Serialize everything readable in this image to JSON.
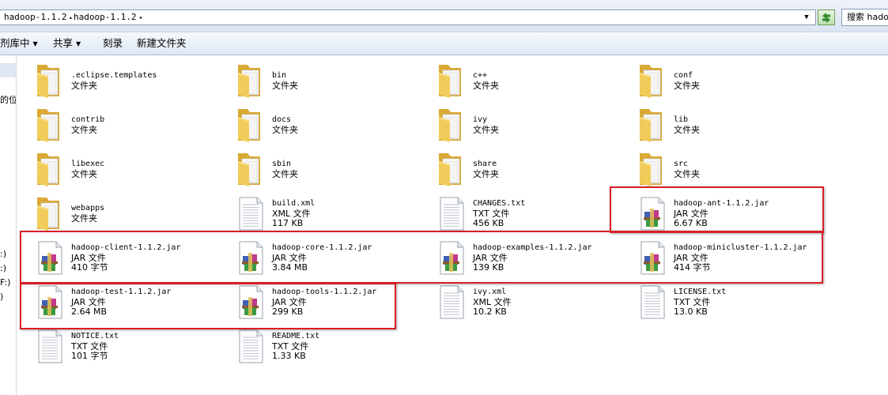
{
  "address_bar": {
    "crumbs": [
      "hadoop-1.1.2",
      "hadoop-1.1.2"
    ],
    "search_label": "搜索 hado"
  },
  "toolbar": {
    "items": [
      {
        "label": "包含到库中",
        "visible_label": "剂库中",
        "dropdown": true
      },
      {
        "label": "共享",
        "dropdown": true
      },
      {
        "label": "刻录",
        "dropdown": false
      },
      {
        "label": "新建文件夹",
        "dropdown": false
      }
    ]
  },
  "nav_pane": {
    "fragments": [
      "的位",
      ":)",
      ":)",
      "F:)",
      ")"
    ]
  },
  "colors": {
    "highlight": "#d91e26",
    "folder": "#f2cc5a"
  },
  "files": [
    {
      "name": ".eclipse.templates",
      "type": "文件夹",
      "icon": "folder-icon"
    },
    {
      "name": "bin",
      "type": "文件夹",
      "icon": "folder-icon"
    },
    {
      "name": "c++",
      "type": "文件夹",
      "icon": "folder-icon"
    },
    {
      "name": "conf",
      "type": "文件夹",
      "icon": "folder-icon"
    },
    {
      "name": "contrib",
      "type": "文件夹",
      "icon": "folder-icon"
    },
    {
      "name": "docs",
      "type": "文件夹",
      "icon": "folder-icon"
    },
    {
      "name": "ivy",
      "type": "文件夹",
      "icon": "folder-icon"
    },
    {
      "name": "lib",
      "type": "文件夹",
      "icon": "folder-icon"
    },
    {
      "name": "libexec",
      "type": "文件夹",
      "icon": "folder-icon"
    },
    {
      "name": "sbin",
      "type": "文件夹",
      "icon": "folder-icon"
    },
    {
      "name": "share",
      "type": "文件夹",
      "icon": "folder-icon"
    },
    {
      "name": "src",
      "type": "文件夹",
      "icon": "folder-icon"
    },
    {
      "name": "webapps",
      "type": "文件夹",
      "icon": "folder-icon"
    },
    {
      "name": "build.xml",
      "type": "XML 文件",
      "size": "117 KB",
      "icon": "document-icon"
    },
    {
      "name": "CHANGES.txt",
      "type": "TXT 文件",
      "size": "456 KB",
      "icon": "document-icon"
    },
    {
      "name": "hadoop-ant-1.1.2.jar",
      "type": "JAR 文件",
      "size": "6.67 KB",
      "icon": "jar-archive-icon"
    },
    {
      "name": "hadoop-client-1.1.2.jar",
      "type": "JAR 文件",
      "size": "410 字节",
      "icon": "jar-archive-icon"
    },
    {
      "name": "hadoop-core-1.1.2.jar",
      "type": "JAR 文件",
      "size": "3.84 MB",
      "icon": "jar-archive-icon"
    },
    {
      "name": "hadoop-examples-1.1.2.jar",
      "type": "JAR 文件",
      "size": "139 KB",
      "icon": "jar-archive-icon"
    },
    {
      "name": "hadoop-minicluster-1.1.2.jar",
      "type": "JAR 文件",
      "size": "414 字节",
      "icon": "jar-archive-icon"
    },
    {
      "name": "hadoop-test-1.1.2.jar",
      "type": "JAR 文件",
      "size": "2.64 MB",
      "icon": "jar-archive-icon"
    },
    {
      "name": "hadoop-tools-1.1.2.jar",
      "type": "JAR 文件",
      "size": "299 KB",
      "icon": "jar-archive-icon"
    },
    {
      "name": "ivy.xml",
      "type": "XML 文件",
      "size": "10.2 KB",
      "icon": "document-icon"
    },
    {
      "name": "LICENSE.txt",
      "type": "TXT 文件",
      "size": "13.0 KB",
      "icon": "document-icon"
    },
    {
      "name": "NOTICE.txt",
      "type": "TXT 文件",
      "size": "101 字节",
      "icon": "document-icon"
    },
    {
      "name": "README.txt",
      "type": "TXT 文件",
      "size": "1.33 KB",
      "icon": "document-icon"
    }
  ]
}
